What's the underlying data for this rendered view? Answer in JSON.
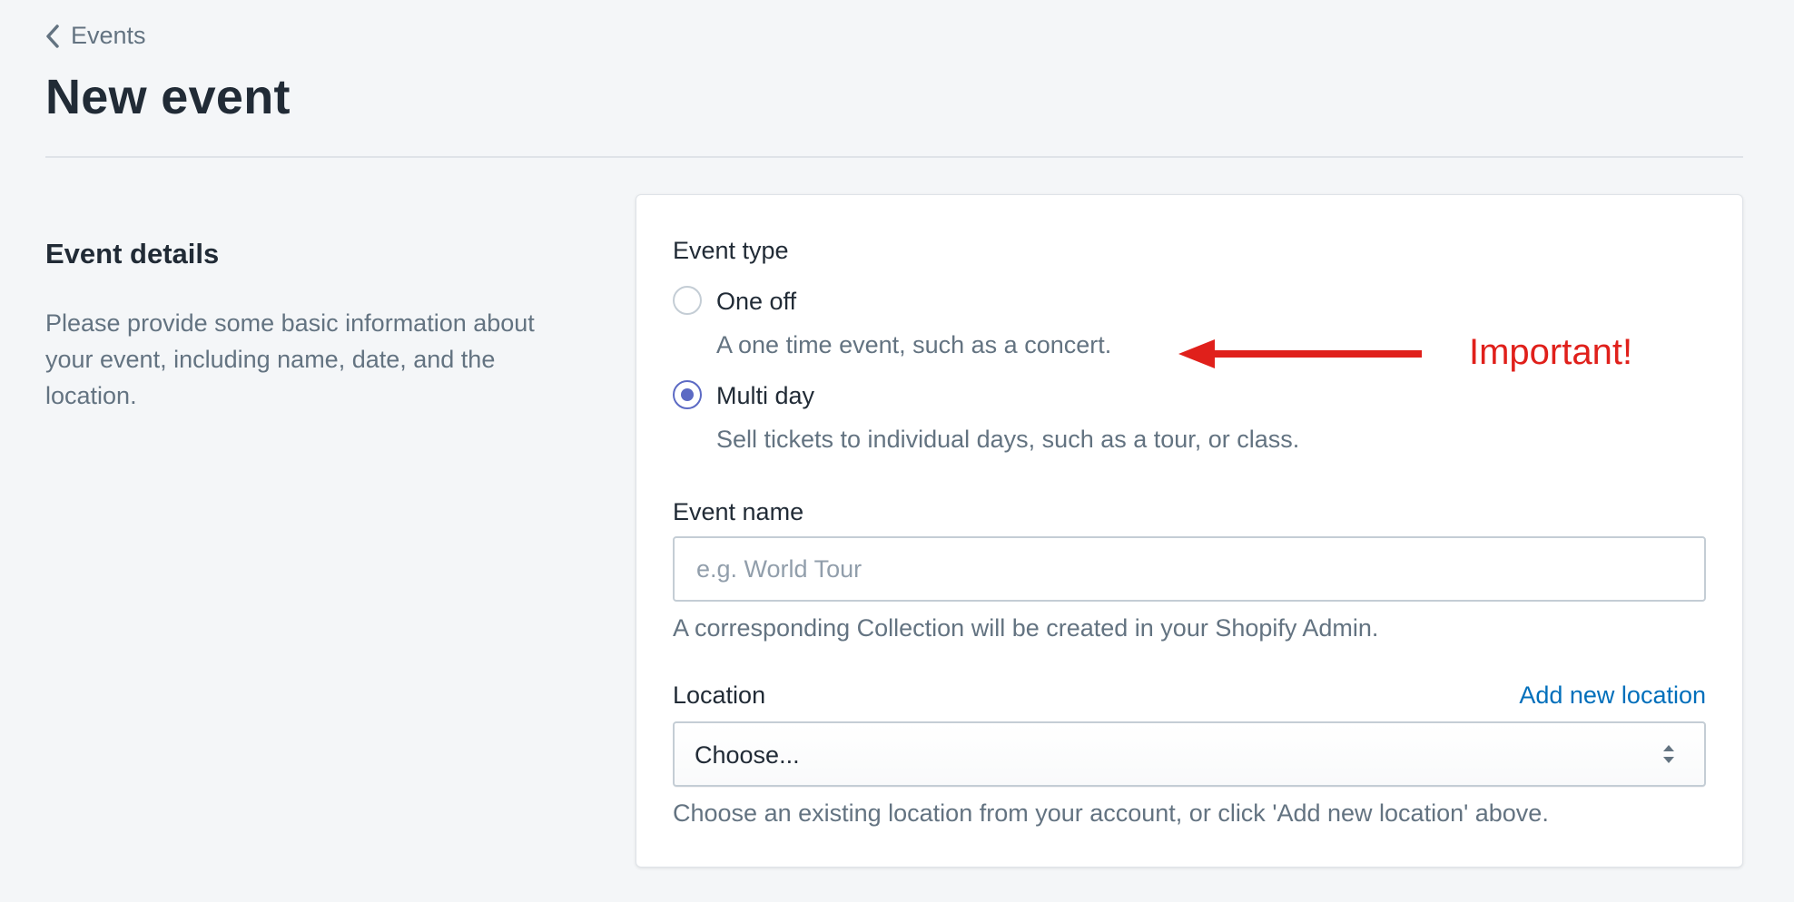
{
  "header": {
    "breadcrumb_label": "Events",
    "title": "New event"
  },
  "section": {
    "title": "Event details",
    "description": "Please provide some basic information about your event, including name, date, and the location."
  },
  "event_type": {
    "label": "Event type",
    "options": [
      {
        "label": "One off",
        "help": "A one time event, such as a concert.",
        "selected": false
      },
      {
        "label": "Multi day",
        "help": "Sell tickets to individual days, such as a tour, or class.",
        "selected": true
      }
    ]
  },
  "event_name": {
    "label": "Event name",
    "value": "",
    "placeholder": "e.g. World Tour",
    "help": "A corresponding Collection will be created in your Shopify Admin."
  },
  "location": {
    "label": "Location",
    "add_link": "Add new location",
    "selected": "Choose...",
    "help": "Choose an existing location from your account, or click 'Add new location' above."
  },
  "annotation": {
    "text": "Important!",
    "color": "#e0201b"
  },
  "colors": {
    "background": "#f4f6f8",
    "radio_accent": "#5c6ac4",
    "link": "#006fbb",
    "muted_text": "#637381"
  },
  "icons": {
    "breadcrumb": "chevron-left-icon",
    "select": "select-arrows-icon",
    "annotation": "arrow-left-icon"
  }
}
